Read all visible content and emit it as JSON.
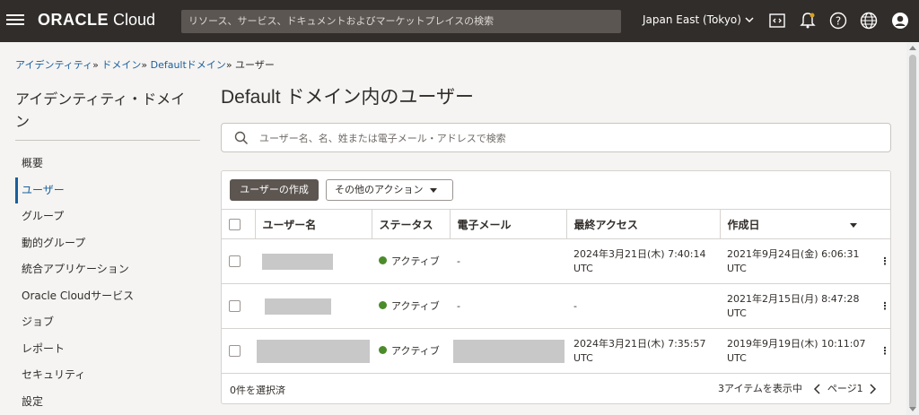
{
  "topbar": {
    "logo_bold": "ORACLE",
    "logo_light": "Cloud",
    "search_placeholder": "リソース、サービス、ドキュメントおよびマーケットプレイスの検索",
    "region": "Japan East (Tokyo)"
  },
  "breadcrumb": {
    "items": [
      "アイデンティティ",
      "ドメイン",
      "Defaultドメイン"
    ],
    "current": "ユーザー",
    "separator": "»"
  },
  "sidebar": {
    "title": "アイデンティティ・ドメイン",
    "items": [
      {
        "label": "概要"
      },
      {
        "label": "ユーザー"
      },
      {
        "label": "グループ"
      },
      {
        "label": "動的グループ"
      },
      {
        "label": "統合アプリケーション"
      },
      {
        "label": "Oracle Cloudサービス"
      },
      {
        "label": "ジョブ"
      },
      {
        "label": "レポート"
      },
      {
        "label": "セキュリティ"
      },
      {
        "label": "設定"
      }
    ],
    "active_index": 1
  },
  "main": {
    "title_prefix": "Default",
    "title_suffix": " ドメイン内のユーザー",
    "search_placeholder": "ユーザー名、名、姓または電子メール・アドレスで検索",
    "create_button": "ユーザーの作成",
    "more_actions": "その他のアクション",
    "columns": [
      "ユーザー名",
      "ステータス",
      "電子メール",
      "最終アクセス",
      "作成日"
    ],
    "rows": [
      {
        "status": "アクティブ",
        "email": "-",
        "last_access": "2024年3月21日(木) 7:40:14 UTC",
        "created": "2021年9月24日(金) 6:06:31 UTC"
      },
      {
        "status": "アクティブ",
        "email": "-",
        "last_access": "-",
        "created": "2021年2月15日(月) 8:47:28 UTC"
      },
      {
        "status": "アクティブ",
        "email": "",
        "last_access": "2024年3月21日(木) 7:35:57 UTC",
        "created": "2019年9月19日(木) 10:11:07 UTC"
      }
    ],
    "selected_text": "0件を選択済",
    "showing_text": "3アイテムを表示中",
    "page_text": "ページ1"
  },
  "colors": {
    "topbar": "#312d2a",
    "active_status": "#4c8b2b",
    "link": "#1a5f9e"
  },
  "icons": [
    "hamburger-icon",
    "cloud-shell-icon",
    "bell-icon",
    "help-icon",
    "globe-icon",
    "profile-icon",
    "search-icon",
    "chevron-left-icon",
    "chevron-right-icon",
    "kebab-icon"
  ]
}
